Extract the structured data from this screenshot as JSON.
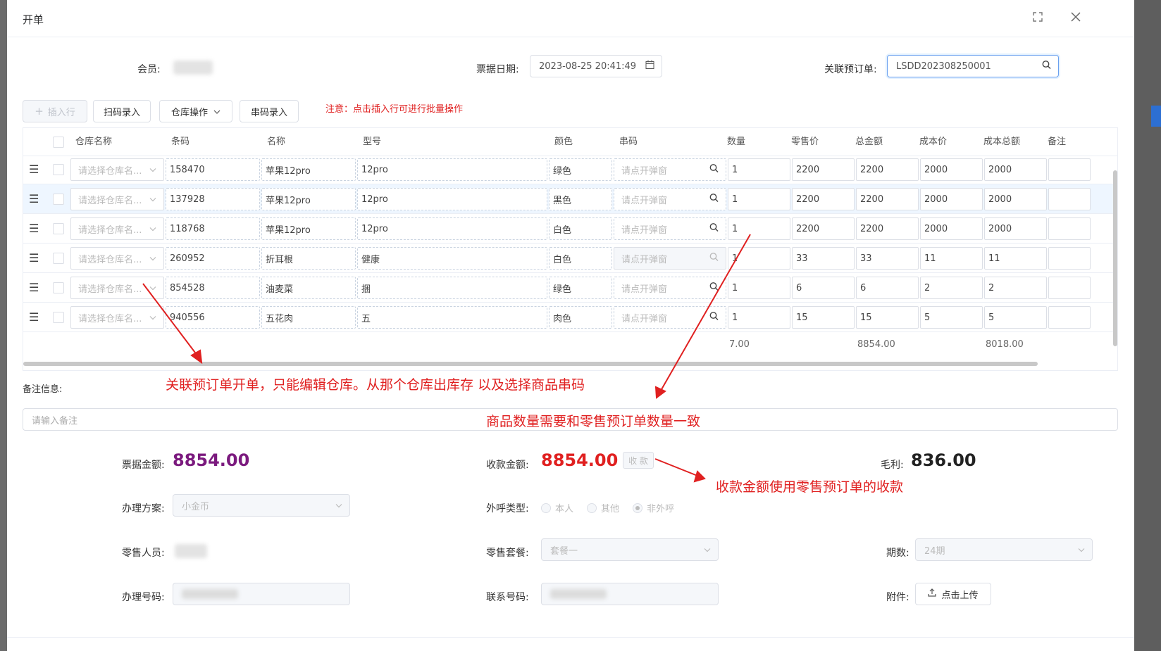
{
  "dialog": {
    "title": "开单"
  },
  "form": {
    "member_label": "会员:",
    "date_label": "票据日期:",
    "date_value": "2023-08-25 20:41:49",
    "related_label": "关联预订单:",
    "related_value": "LSDD202308250001"
  },
  "toolbar": {
    "insert_row": "插入行",
    "scan_entry": "扫码录入",
    "warehouse_ops": "仓库操作",
    "serial_entry": "串码录入",
    "note": "注意：点击插入行可进行批量操作"
  },
  "table": {
    "headers": [
      "仓库名称",
      "条码",
      "名称",
      "型号",
      "颜色",
      "串码",
      "数量",
      "零售价",
      "总金额",
      "成本价",
      "成本总额",
      "备注"
    ],
    "warehouse_placeholder": "请选择仓库名...",
    "serial_placeholder": "请点开弹窗",
    "rows": [
      {
        "barcode": "158470",
        "name": "苹果12pro",
        "model": "12pro",
        "color": "绿色",
        "qty": "1",
        "price": "2200",
        "total": "2200",
        "cost": "2000",
        "cost_total": "2000"
      },
      {
        "barcode": "137928",
        "name": "苹果12pro",
        "model": "12pro",
        "color": "黑色",
        "qty": "1",
        "price": "2200",
        "total": "2200",
        "cost": "2000",
        "cost_total": "2000"
      },
      {
        "barcode": "118768",
        "name": "苹果12pro",
        "model": "12pro",
        "color": "白色",
        "qty": "1",
        "price": "2200",
        "total": "2200",
        "cost": "2000",
        "cost_total": "2000"
      },
      {
        "barcode": "260952",
        "name": "折耳根",
        "model": "健康",
        "color": "白色",
        "qty": "1",
        "price": "33",
        "total": "33",
        "cost": "11",
        "cost_total": "11"
      },
      {
        "barcode": "854528",
        "name": "油麦菜",
        "model": "捆",
        "color": "绿色",
        "qty": "1",
        "price": "6",
        "total": "6",
        "cost": "2",
        "cost_total": "2"
      },
      {
        "barcode": "940556",
        "name": "五花肉",
        "model": "五",
        "color": "肉色",
        "qty": "1",
        "price": "15",
        "total": "15",
        "cost": "5",
        "cost_total": "5"
      }
    ],
    "summary": {
      "qty": "7.00",
      "total": "8854.00",
      "cost_total": "8018.00"
    }
  },
  "remarks": {
    "label": "备注信息:",
    "placeholder": "请输入备注"
  },
  "annotations": {
    "a1": "关联预订单开单，只能编辑仓库。从那个仓库出库存 以及选择商品串码",
    "a2": "商品数量需要和零售预订单数量一致",
    "a3": "收款金额使用零售预订单的收款"
  },
  "amounts": {
    "bill_label": "票据金额:",
    "bill_value": "8854.00",
    "received_label": "收款金额:",
    "received_value": "8854.00",
    "collect_button": "收 款",
    "profit_label": "毛利:",
    "profit_value": "836.00"
  },
  "details": {
    "plan_label": "办理方案:",
    "plan_value": "小金币",
    "call_label": "外呼类型:",
    "call_options": [
      "本人",
      "其他",
      "非外呼"
    ],
    "sales_label": "零售人员:",
    "package_label": "零售套餐:",
    "package_value": "套餐一",
    "period_label": "期数:",
    "period_value": "24期",
    "number_label": "办理号码:",
    "contact_label": "联系号码:",
    "attach_label": "附件:",
    "upload_label": "点击上传"
  },
  "colors": {
    "bill_amount": "#7b1a7e",
    "received_amount": "#e02020",
    "annotation": "#e02020"
  }
}
